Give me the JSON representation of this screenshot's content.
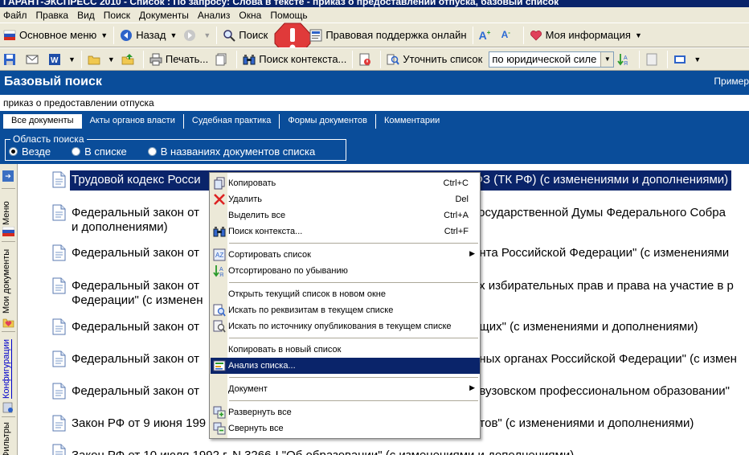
{
  "window": {
    "title": "ГАРАНТ-ЭКСПРЕСС 2010 - Список : По запросу: Слова в тексте - приказ о предоставлении отпуска, базовый список"
  },
  "menubar": [
    "Файл",
    "Правка",
    "Вид",
    "Поиск",
    "Документы",
    "Анализ",
    "Окна",
    "Помощь"
  ],
  "toolbar1": {
    "main_menu": "Основное меню",
    "back": "Назад",
    "search": "Поиск",
    "legal_support": "Правовая поддержка онлайн",
    "my_info": "Моя информация"
  },
  "toolbar2": {
    "print": "Печать...",
    "context_search": "Поиск контекста...",
    "refine_list": "Уточнить список",
    "sort_combo": "по юридической силе"
  },
  "basic_search": {
    "title": "Базовый поиск",
    "examples": "Пример",
    "query": "приказ о предоставлении отпуска",
    "tabs": [
      "Все документы",
      "Акты органов власти",
      "Судебная практика",
      "Формы документов",
      "Комментарии"
    ],
    "scope_label": "Область поиска",
    "scope_options": [
      "Везде",
      "В списке",
      "В названиях документов списка"
    ],
    "scope_selected": 0
  },
  "sidebar": {
    "items": [
      "Меню",
      "Мои документы",
      "Конфигурации",
      "Фильтры"
    ]
  },
  "documents": [
    {
      "text": "Трудовой кодекс Российской Федерации от 30 декабря 2001 г. N 197-ФЗ (ТК РФ) (с изменениями и дополнениями)",
      "visible": "Трудовой кодекс Росси",
      "tail": "ФЗ (ТК РФ) (с изменениями и дополнениями)"
    },
    {
      "visible": "Федеральный закон от",
      "tail": "Государственной Думы Федерального Собра",
      "line2": "и дополнениями)"
    },
    {
      "visible": "Федеральный закон от",
      "tail": "ента Российской Федерации\" (с изменениями"
    },
    {
      "visible": "Федеральный закон от",
      "tail": "ях избирательных прав и права на участие в р",
      "line2": "Федерации\" (с изменен"
    },
    {
      "visible": "Федеральный закон от",
      "tail": "ащих\" (с изменениями и дополнениями)"
    },
    {
      "visible": "Федеральный закон от",
      "tail": "нных органах Российской Федерации\" (с измен"
    },
    {
      "visible": "Федеральный закон от",
      "tail": "евузовском профессиональном образовании\""
    },
    {
      "visible": "Закон РФ от 9 июня 199",
      "tail": "нтов\" (с изменениями и дополнениями)"
    },
    {
      "visible": "Закон РФ от 10 июля 1992 г. N 3266-I \"Об образовании\" (с изменениями и дополнениями)",
      "tail": ""
    }
  ],
  "context_menu": {
    "items": [
      {
        "label": "Копировать",
        "shortcut": "Ctrl+C",
        "icon": "copy-icon"
      },
      {
        "label": "Удалить",
        "shortcut": "Del",
        "icon": "delete-icon"
      },
      {
        "label": "Выделить все",
        "shortcut": "Ctrl+A",
        "icon": ""
      },
      {
        "label": "Поиск контекста...",
        "shortcut": "Ctrl+F",
        "icon": "binoculars-icon"
      },
      {
        "label": "Сортировать список",
        "shortcut": "",
        "icon": "sort-icon",
        "submenu": true
      },
      {
        "label": "Отсортировано по убыванию",
        "shortcut": "",
        "icon": "sort-desc-icon"
      },
      {
        "label": "Открыть текущий список в новом окне",
        "shortcut": "",
        "icon": ""
      },
      {
        "label": "Искать по реквизитам в текущем списке",
        "shortcut": "",
        "icon": "search-attrs-icon"
      },
      {
        "label": "Искать по источнику опубликования в текущем списке",
        "shortcut": "",
        "icon": "search-source-icon"
      },
      {
        "label": "Копировать в новый список",
        "shortcut": "",
        "icon": ""
      },
      {
        "label": "Анализ списка...",
        "shortcut": "",
        "icon": "analysis-icon",
        "highlighted": true
      },
      {
        "label": "Документ",
        "shortcut": "",
        "icon": "",
        "submenu": true
      },
      {
        "label": "Развернуть все",
        "shortcut": "",
        "icon": "expand-all-icon"
      },
      {
        "label": "Свернуть все",
        "shortcut": "",
        "icon": "collapse-all-icon"
      }
    ]
  },
  "colors": {
    "header_band": "#0a4d9a",
    "selection": "#0a246a",
    "toolbar": "#ece9d8",
    "alert": "#e03a3a"
  }
}
